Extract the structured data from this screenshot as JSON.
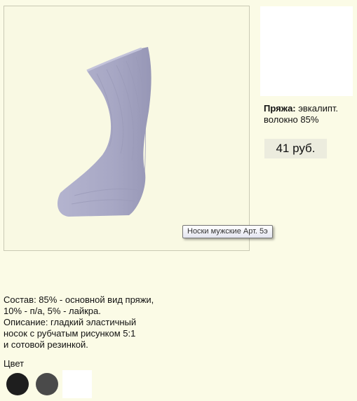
{
  "product": {
    "image_tooltip": "Носки мужские Арт. 5э",
    "yarn_label": "Пряжа:",
    "yarn_value": "эвкалипт. волокно 85%",
    "price": "41 руб.",
    "description_lines": [
      "Состав: 85% - основной вид пряжи,",
      "10% - п/а, 5% - лайкра.",
      "Описание: гладкий эластичный",
      "носок с рубчатым рисунком 5:1",
      "и сотовой резинкой."
    ],
    "color_label": "Цвет",
    "colors": [
      "#1e1e1e",
      "#4a4a4a",
      "#ffffff"
    ],
    "sock_color": "#a9a9c6"
  }
}
